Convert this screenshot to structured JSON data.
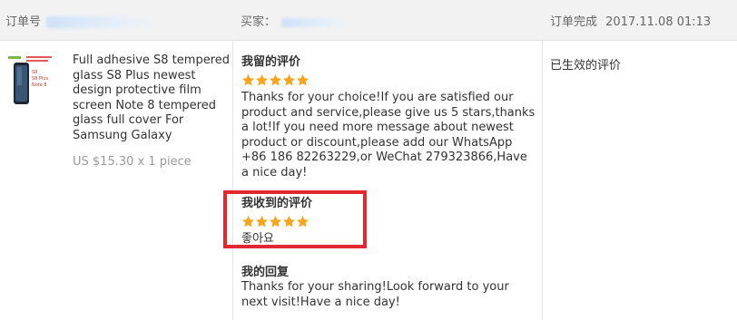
{
  "header": {
    "order_no_label": "订单号",
    "buyer_label": "买家：",
    "completed_label": "订单完成",
    "completed_time": "2017.11.08 01:13"
  },
  "product": {
    "title": "Full adhesive S8 tempered glass S8 Plus newest design protective film screen Note 8 tempered glass full cover For Samsung Galaxy",
    "price": "US $15.30 x 1 piece",
    "thumb_labels": [
      "S8",
      "S8 Plus",
      "Note 8"
    ]
  },
  "my_review": {
    "title": "我留的评价",
    "stars": 5,
    "text": "Thanks for your choice!If you are satisfied our product and service,please give us 5 stars,thanks a lot!If you need more message about newest product or discount,please add our WhatsApp +86 186 82263229,or WeChat 279323866,Have a nice day!"
  },
  "received_review": {
    "title": "我收到的评价",
    "stars": 5,
    "text": "좋아요"
  },
  "my_reply": {
    "title": "我的回复",
    "text": "Thanks for your sharing!Look forward to your next visit!Have a nice day!"
  },
  "status": {
    "label": "已生效的评价"
  },
  "colors": {
    "star": "#f7a51c",
    "highlight_box": "#e0282e",
    "header_bg": "#f2f2f2"
  }
}
